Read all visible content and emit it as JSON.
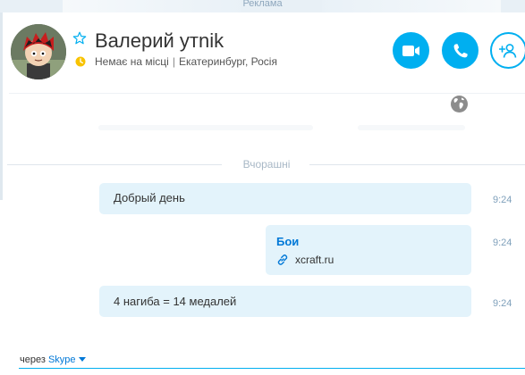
{
  "ad_bar": {
    "label": "Реклама"
  },
  "contact": {
    "name": "Валерий утnik",
    "status": "Немає на місці",
    "location": "Екатеринбург, Росія",
    "status_color": "#f8c300"
  },
  "actions": {
    "video_call_icon": "video-camera-icon",
    "audio_call_icon": "phone-icon",
    "add_contact_icon": "add-person-icon"
  },
  "conversation": {
    "day_separator": "Вчорашні",
    "messages": [
      {
        "text": "Добрый день",
        "time": "9:24"
      },
      {
        "link_title": "Бои",
        "link_url": "xcraft.ru",
        "time": "9:24"
      },
      {
        "text": "4 нагиба = 14 медалей",
        "time": "9:24"
      }
    ]
  },
  "composer": {
    "via_label": "через",
    "service": "Skype"
  },
  "colors": {
    "accent": "#00aff0",
    "bubble": "#e3f3fb",
    "link": "#0078d7",
    "timestamp": "#7fa0bb"
  }
}
